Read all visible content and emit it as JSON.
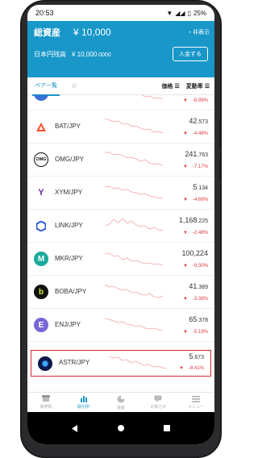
{
  "status": {
    "time": "20:53",
    "battery": "25%"
  },
  "header": {
    "total_label": "総資産",
    "total_value": "¥ 10,000",
    "hide_label": "・非表示",
    "jpy_label": "日本円残高",
    "jpy_value": "¥ 10,000",
    "jpy_decimals": ".0000",
    "deposit_label": "入金する"
  },
  "tabs": {
    "pair_tab": "ペア一覧",
    "fav_tab": "☆",
    "sort_price": "価格 ☰",
    "sort_change": "変動率 ☰"
  },
  "rows": [
    {
      "pair": "",
      "price_int": "",
      "price_dec": "",
      "change": "-6.99%",
      "icon": "partial-coin-icon",
      "color": "#3a6fd8"
    },
    {
      "pair": "BAT/JPY",
      "price_int": "42",
      "price_dec": ".573",
      "change": "-4.48%",
      "icon": "bat-icon",
      "color": "#ff4f2e"
    },
    {
      "pair": "OMG/JPY",
      "price_int": "241",
      "price_dec": ".763",
      "change": "-7.17%",
      "icon": "omg-icon",
      "color": "#111111"
    },
    {
      "pair": "XYM/JPY",
      "price_int": "5",
      "price_dec": ".134",
      "change": "-4.66%",
      "icon": "xym-icon",
      "color": "#6b1ea0"
    },
    {
      "pair": "LINK/JPY",
      "price_int": "1,168",
      "price_dec": ".225",
      "change": "-2.48%",
      "icon": "link-icon",
      "color": "#2a5ada"
    },
    {
      "pair": "MKR/JPY",
      "price_int": "100,224",
      "price_dec": "",
      "change": "-9.30%",
      "icon": "mkr-icon",
      "color": "#1aab9b"
    },
    {
      "pair": "BOBA/JPY",
      "price_int": "41",
      "price_dec": ".389",
      "change": "-3.38%",
      "icon": "boba-icon",
      "color": "#111111"
    },
    {
      "pair": "ENJ/JPY",
      "price_int": "65",
      "price_dec": ".378",
      "change": "-5.19%",
      "icon": "enj-icon",
      "color": "#7866d5"
    },
    {
      "pair": "ASTR/JPY",
      "price_int": "5",
      "price_dec": ".673",
      "change": "-8.41%",
      "icon": "astr-icon",
      "color": "#0a1a4a"
    }
  ],
  "nav": [
    {
      "label": "販売所",
      "icon": "shop-icon"
    },
    {
      "label": "取引所",
      "icon": "bar-chart-icon"
    },
    {
      "label": "資産",
      "icon": "pie-chart-icon"
    },
    {
      "label": "お知らせ",
      "icon": "message-icon"
    },
    {
      "label": "メニュー",
      "icon": "menu-icon"
    }
  ],
  "colors": {
    "brand": "#1897c8",
    "down": "#e0383e",
    "highlight": "#d6282d"
  }
}
